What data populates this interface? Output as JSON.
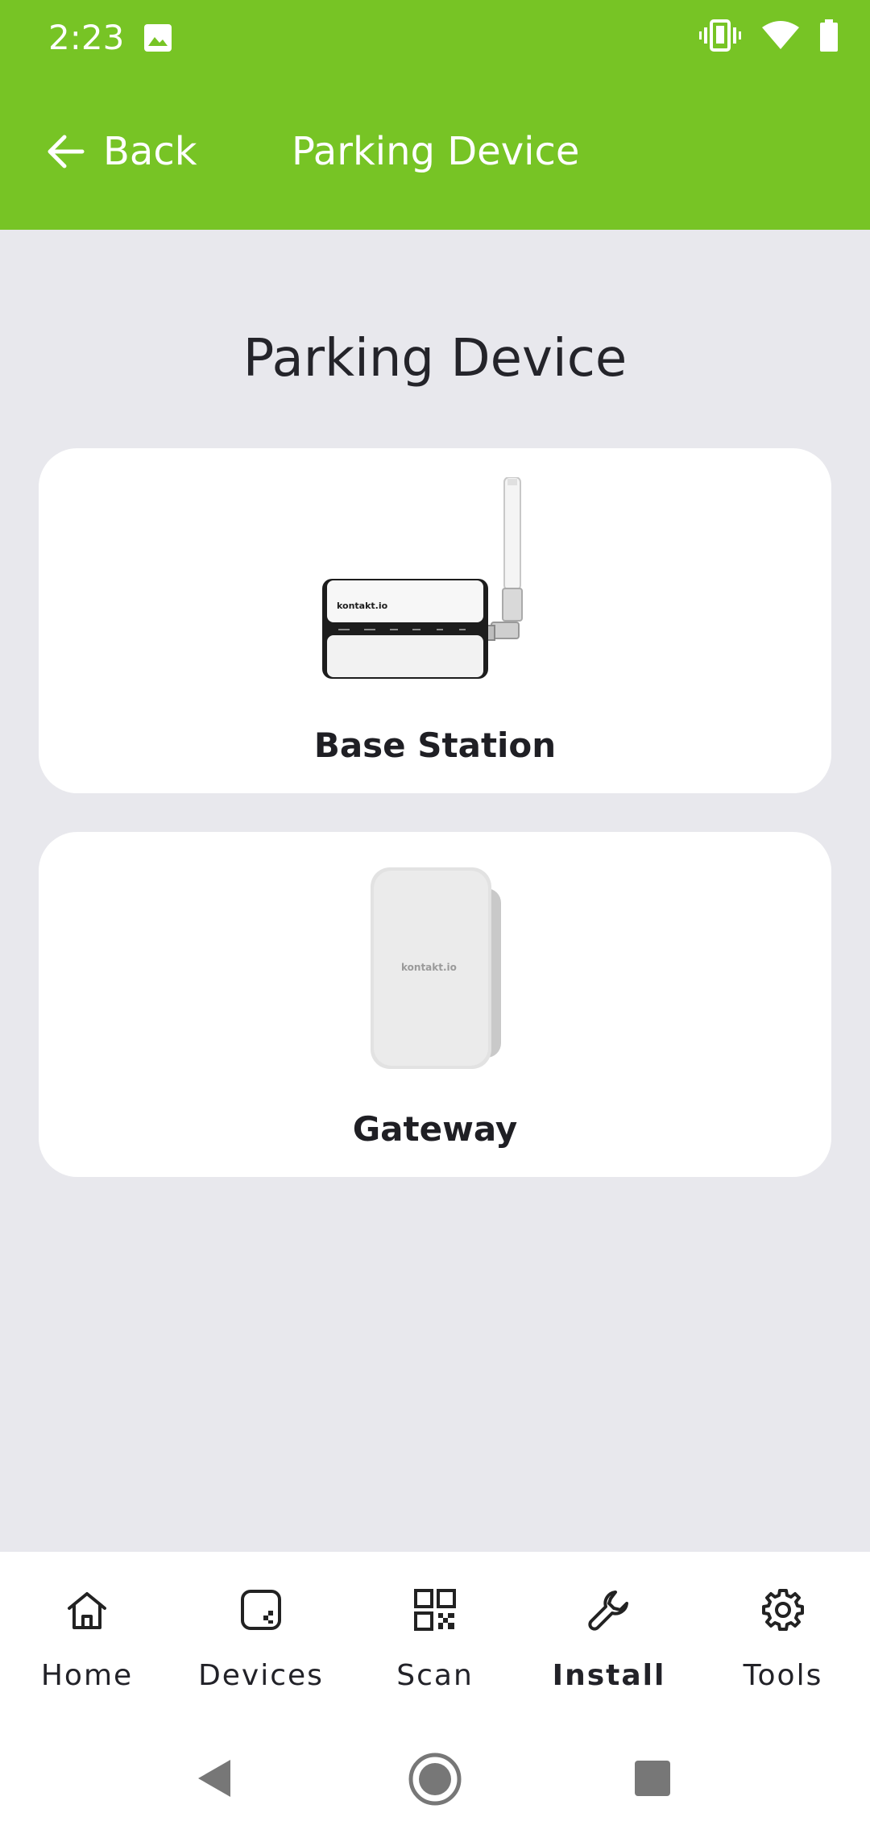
{
  "status_bar": {
    "time": "2:23",
    "icons": [
      "image-icon",
      "vibrate-icon",
      "wifi-icon",
      "battery-icon"
    ]
  },
  "app_bar": {
    "back_label": "Back",
    "title": "Parking Device",
    "background_color": "#77c425"
  },
  "main": {
    "heading": "Parking Device",
    "cards": [
      {
        "label": "Base Station",
        "image": "base-station-device-image",
        "brand": "kontakt.io"
      },
      {
        "label": "Gateway",
        "image": "gateway-device-image",
        "brand": "kontakt.io"
      }
    ]
  },
  "bottom_nav": {
    "items": [
      {
        "label": "Home",
        "icon": "home-icon",
        "active": false
      },
      {
        "label": "Devices",
        "icon": "devices-icon",
        "active": false
      },
      {
        "label": "Scan",
        "icon": "qr-code-icon",
        "active": false
      },
      {
        "label": "Install",
        "icon": "wrench-icon",
        "active": true
      },
      {
        "label": "Tools",
        "icon": "gear-icon",
        "active": false
      }
    ]
  },
  "system_nav": {
    "buttons": [
      "back-triangle-icon",
      "home-circle-icon",
      "recents-square-icon"
    ]
  }
}
